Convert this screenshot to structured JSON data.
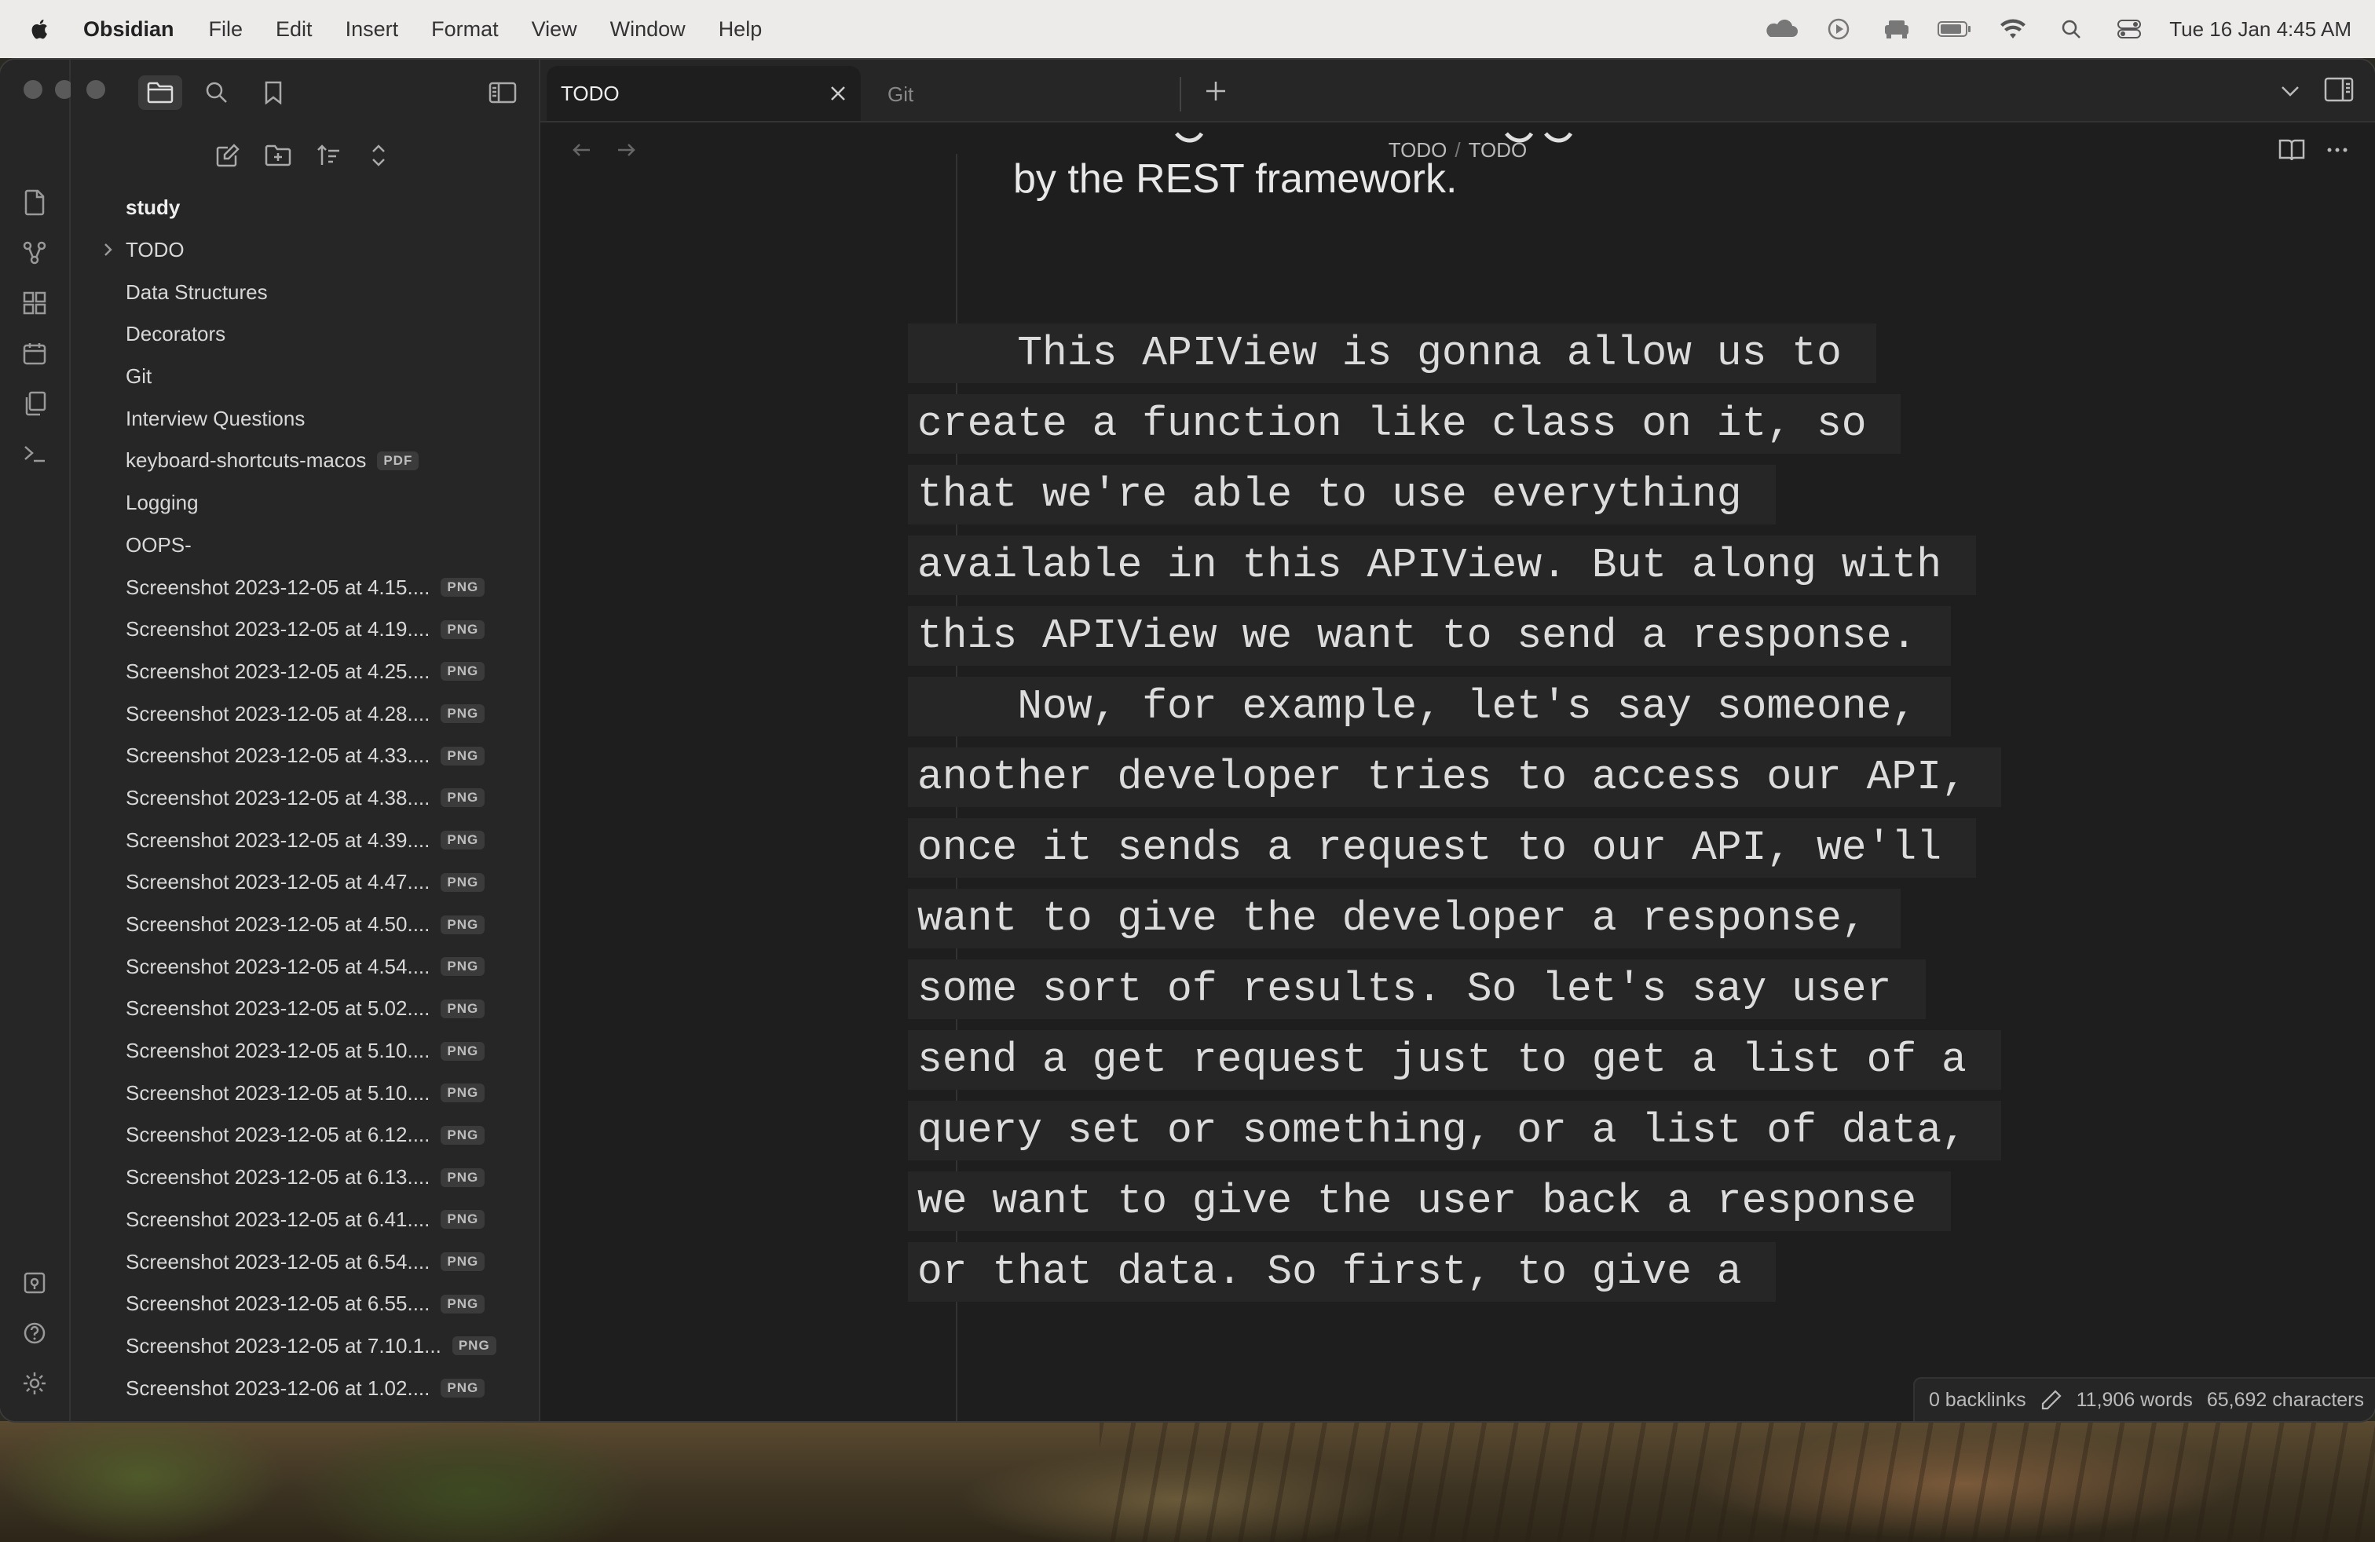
{
  "menubar": {
    "app_name": "Obsidian",
    "items": [
      "File",
      "Edit",
      "Insert",
      "Format",
      "View",
      "Window",
      "Help"
    ],
    "clock": "Tue 16 Jan  4:45 AM"
  },
  "tabs": [
    {
      "label": "TODO",
      "active": true
    },
    {
      "label": "Git",
      "active": false
    }
  ],
  "breadcrumb": {
    "parent": "TODO",
    "separator": "/",
    "current": "TODO"
  },
  "sidebar": {
    "root": "study",
    "items": [
      {
        "label": "TODO",
        "type": "folder"
      },
      {
        "label": "Data Structures"
      },
      {
        "label": "Decorators"
      },
      {
        "label": "Git"
      },
      {
        "label": "Interview Questions"
      },
      {
        "label": "keyboard-shortcuts-macos",
        "badge": "PDF"
      },
      {
        "label": "Logging"
      },
      {
        "label": "OOPS-"
      },
      {
        "label": "Screenshot 2023-12-05 at 4.15....",
        "badge": "PNG"
      },
      {
        "label": "Screenshot 2023-12-05 at 4.19....",
        "badge": "PNG"
      },
      {
        "label": "Screenshot 2023-12-05 at 4.25....",
        "badge": "PNG"
      },
      {
        "label": "Screenshot 2023-12-05 at 4.28....",
        "badge": "PNG"
      },
      {
        "label": "Screenshot 2023-12-05 at 4.33....",
        "badge": "PNG"
      },
      {
        "label": "Screenshot 2023-12-05 at 4.38....",
        "badge": "PNG"
      },
      {
        "label": "Screenshot 2023-12-05 at 4.39....",
        "badge": "PNG"
      },
      {
        "label": "Screenshot 2023-12-05 at 4.47....",
        "badge": "PNG"
      },
      {
        "label": "Screenshot 2023-12-05 at 4.50....",
        "badge": "PNG"
      },
      {
        "label": "Screenshot 2023-12-05 at 4.54....",
        "badge": "PNG"
      },
      {
        "label": "Screenshot 2023-12-05 at 5.02....",
        "badge": "PNG"
      },
      {
        "label": "Screenshot 2023-12-05 at 5.10....",
        "badge": "PNG"
      },
      {
        "label": "Screenshot 2023-12-05 at 5.10....",
        "badge": "PNG"
      },
      {
        "label": "Screenshot 2023-12-05 at 6.12....",
        "badge": "PNG"
      },
      {
        "label": "Screenshot 2023-12-05 at 6.13....",
        "badge": "PNG"
      },
      {
        "label": "Screenshot 2023-12-05 at 6.41....",
        "badge": "PNG"
      },
      {
        "label": "Screenshot 2023-12-05 at 6.54....",
        "badge": "PNG"
      },
      {
        "label": "Screenshot 2023-12-05 at 6.55....",
        "badge": "PNG"
      },
      {
        "label": "Screenshot 2023-12-05 at 7.10.1...",
        "badge": "PNG"
      },
      {
        "label": "Screenshot 2023-12-06 at 1.02....",
        "badge": "PNG"
      }
    ]
  },
  "editor": {
    "prose_line": "by the REST framework.",
    "code_lines": [
      "    This APIView is gonna allow us to ",
      "create a function like class on it, so ",
      "that we're able to use everything ",
      "available in this APIView. But along with ",
      "this APIView we want to send a response. ",
      "    Now, for example, let's say someone, ",
      "another developer tries to access our API, ",
      "once it sends a request to our API, we'll ",
      "want to give the developer a response, ",
      "some sort of results. So let's say user ",
      "send a get request just to get a list of a ",
      "query set or something, or a list of data, ",
      "we want to give the user back a response ",
      "or that data. So first, to give a "
    ]
  },
  "statusbar": {
    "backlinks": "0 backlinks",
    "words": "11,906 words",
    "characters": "65,692 characters"
  }
}
